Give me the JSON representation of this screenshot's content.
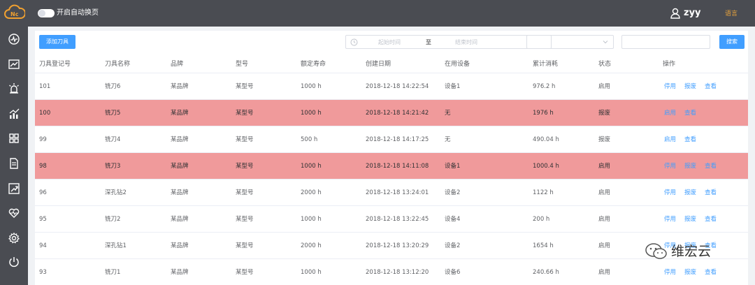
{
  "header": {
    "auto_page_label": "开启自动换页",
    "username": "zyy",
    "language_label": "语言"
  },
  "toolbar": {
    "add_button": "添加刀具",
    "start_placeholder": "起始时间",
    "range_separator": "至",
    "end_placeholder": "结束时间",
    "search_button": "搜索"
  },
  "table": {
    "headers": [
      "刀具登记号",
      "刀具名称",
      "品牌",
      "型号",
      "额定寿命",
      "创建日期",
      "在用设备",
      "累计消耗",
      "状态",
      "操作"
    ],
    "rows": [
      {
        "id": "101",
        "name": "铣刀6",
        "brand": "某品牌",
        "model": "某型号",
        "life": "1000 h",
        "date": "2018-12-18 14:22:54",
        "device": "设备1",
        "usage": "976.2 h",
        "status": "启用",
        "ops": [
          "停用",
          "报废",
          "查看"
        ],
        "highlight": false
      },
      {
        "id": "100",
        "name": "铣刀5",
        "brand": "某品牌",
        "model": "某型号",
        "life": "1000 h",
        "date": "2018-12-18 14:21:42",
        "device": "无",
        "usage": "1976 h",
        "status": "报废",
        "ops": [
          "启用",
          "查看"
        ],
        "highlight": true
      },
      {
        "id": "99",
        "name": "铣刀4",
        "brand": "某品牌",
        "model": "某型号",
        "life": "500 h",
        "date": "2018-12-18 14:17:25",
        "device": "无",
        "usage": "490.04 h",
        "status": "报废",
        "ops": [
          "启用",
          "查看"
        ],
        "highlight": false
      },
      {
        "id": "98",
        "name": "铣刀3",
        "brand": "某品牌",
        "model": "某型号",
        "life": "1000 h",
        "date": "2018-12-18 14:11:08",
        "device": "设备1",
        "usage": "1000.4 h",
        "status": "启用",
        "ops": [
          "停用",
          "报废",
          "查看"
        ],
        "highlight": true
      },
      {
        "id": "96",
        "name": "深孔钻2",
        "brand": "某品牌",
        "model": "某型号",
        "life": "2000 h",
        "date": "2018-12-18 13:24:01",
        "device": "设备2",
        "usage": "1122 h",
        "status": "启用",
        "ops": [
          "停用",
          "报废",
          "查看"
        ],
        "highlight": false
      },
      {
        "id": "95",
        "name": "铣刀2",
        "brand": "某品牌",
        "model": "某型号",
        "life": "1000 h",
        "date": "2018-12-18 13:22:45",
        "device": "设备4",
        "usage": "200 h",
        "status": "启用",
        "ops": [
          "停用",
          "报废",
          "查看"
        ],
        "highlight": false
      },
      {
        "id": "94",
        "name": "深孔钻1",
        "brand": "某品牌",
        "model": "某型号",
        "life": "2000 h",
        "date": "2018-12-18 13:20:29",
        "device": "设备2",
        "usage": "1654 h",
        "status": "启用",
        "ops": [
          "停用",
          "报废",
          "查看"
        ],
        "highlight": false
      },
      {
        "id": "93",
        "name": "铣刀1",
        "brand": "某品牌",
        "model": "某型号",
        "life": "1000 h",
        "date": "2018-12-18 13:12:20",
        "device": "设备6",
        "usage": "240.66 h",
        "status": "启用",
        "ops": [
          "停用",
          "报废",
          "查看"
        ],
        "highlight": false
      }
    ]
  },
  "watermark": {
    "text": "维宏云"
  },
  "colors": {
    "topbar": "#4a4c52",
    "accent": "#409eff",
    "highlight_row": "#f09a9b",
    "language": "#e6a23c"
  },
  "icons": {
    "sidebar": [
      "dashboard-icon",
      "line-chart-icon",
      "alarm-icon",
      "bar-chart-icon",
      "grid-icon",
      "document-icon",
      "report-icon",
      "heart-icon",
      "settings-icon",
      "power-icon"
    ]
  }
}
